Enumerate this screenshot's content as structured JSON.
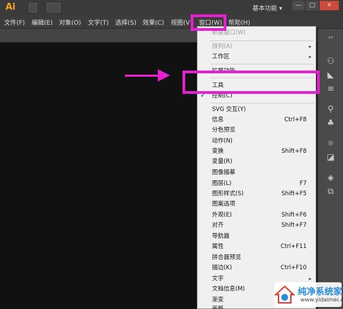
{
  "app": {
    "logo": "Ai",
    "workspace": "基本功能",
    "workspace_arrow": "▾"
  },
  "window_controls": {
    "minimize": "—",
    "restore": "□",
    "close": "✕"
  },
  "menubar": {
    "items": [
      "文件(F)",
      "编辑(E)",
      "对象(O)",
      "文字(T)",
      "选择(S)",
      "效果(C)",
      "视图(V",
      "窗口(W)",
      "帮助(H)"
    ]
  },
  "dropdown": {
    "new_window": "新建窗口(W)",
    "items": [
      {
        "label": "排列(A)",
        "shortcut": "",
        "submenu": true,
        "disabled": true
      },
      {
        "label": "工作区",
        "shortcut": "",
        "submenu": true,
        "disabled": false
      },
      {
        "label": "扩展功能",
        "shortcut": "",
        "submenu": true,
        "disabled": false
      },
      {
        "label": "工具",
        "shortcut": "",
        "submenu": false,
        "disabled": false
      },
      {
        "label": "控制(C)",
        "shortcut": "",
        "submenu": false,
        "disabled": false,
        "checked": true
      },
      {
        "label": "SVG 交互(Y)",
        "shortcut": "",
        "submenu": false
      },
      {
        "label": "信息",
        "shortcut": "Ctrl+F8",
        "submenu": false
      },
      {
        "label": "分色预览",
        "shortcut": "",
        "submenu": false
      },
      {
        "label": "动作(N)",
        "shortcut": "",
        "submenu": false
      },
      {
        "label": "变换",
        "shortcut": "Shift+F8",
        "submenu": false
      },
      {
        "label": "变量(R)",
        "shortcut": "",
        "submenu": false
      },
      {
        "label": "图像描摹",
        "shortcut": "",
        "submenu": false
      },
      {
        "label": "图层(L)",
        "shortcut": "F7",
        "submenu": false
      },
      {
        "label": "图形样式(S)",
        "shortcut": "Shift+F5",
        "submenu": false
      },
      {
        "label": "图案选项",
        "shortcut": "",
        "submenu": false
      },
      {
        "label": "外观(E)",
        "shortcut": "Shift+F6",
        "submenu": false
      },
      {
        "label": "对齐",
        "shortcut": "Shift+F7",
        "submenu": false
      },
      {
        "label": "导航器",
        "shortcut": "",
        "submenu": false
      },
      {
        "label": "属性",
        "shortcut": "Ctrl+F11",
        "submenu": false
      },
      {
        "label": "拼合器预览",
        "shortcut": "",
        "submenu": false
      },
      {
        "label": "描边(K)",
        "shortcut": "Ctrl+F10",
        "submenu": false
      },
      {
        "label": "文字",
        "shortcut": "",
        "submenu": true
      },
      {
        "label": "文档信息(M)",
        "shortcut": "",
        "submenu": false
      },
      {
        "label": "渐变",
        "shortcut": "",
        "submenu": false
      },
      {
        "label": "画板",
        "shortcut": "",
        "submenu": false
      }
    ]
  },
  "watermark": {
    "title": "纯净系统家园",
    "url": "www.yidaimei.com"
  },
  "colors": {
    "highlight": "#e61fd0",
    "menu_bg": "#f0f0f0",
    "canvas": "#111111",
    "check": "#2a7fd6"
  },
  "icons": {
    "submenu": "chevron-right-icon",
    "check": "checkmark-icon"
  }
}
